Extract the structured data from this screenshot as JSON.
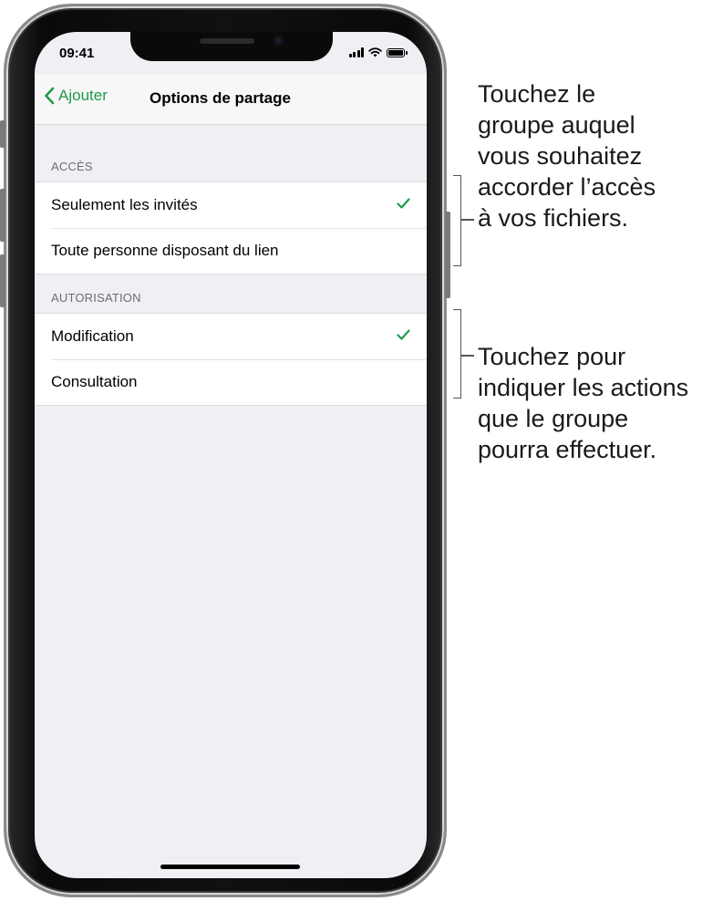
{
  "status_bar": {
    "time": "09:41"
  },
  "nav": {
    "back_label": "Ajouter",
    "title": "Options de partage"
  },
  "access": {
    "header": "ACCÈS",
    "items": [
      {
        "label": "Seulement les invités",
        "checked": true
      },
      {
        "label": "Toute personne disposant du lien",
        "checked": false
      }
    ]
  },
  "permission": {
    "header": "AUTORISATION",
    "items": [
      {
        "label": "Modification",
        "checked": true
      },
      {
        "label": "Consultation",
        "checked": false
      }
    ]
  },
  "annotations": {
    "access_callout": "Touchez le\ngroupe auquel\nvous souhaitez\naccorder l’accès\nà vos fichiers.",
    "permission_callout": "Touchez pour\nindiquer les actions\nque le groupe\npourra effectuer."
  },
  "colors": {
    "accent": "#1f9b4a",
    "background": "#efeff4"
  },
  "icons": {
    "back": "chevron-left-icon",
    "check": "checkmark-icon"
  }
}
